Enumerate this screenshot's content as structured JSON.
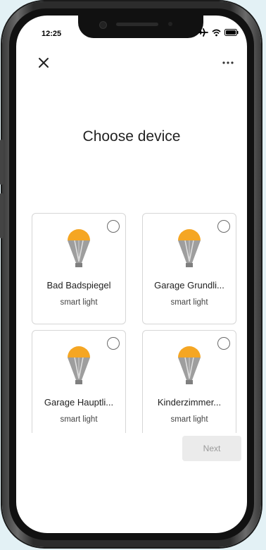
{
  "status_bar": {
    "time": "12:25"
  },
  "header": {
    "title": "Choose device"
  },
  "devices": [
    {
      "name": "Bad Badspiegel",
      "type": "smart light"
    },
    {
      "name": "Garage Grundli...",
      "type": "smart light"
    },
    {
      "name": "Garage Hauptli...",
      "type": "smart light"
    },
    {
      "name": "Kinderzimmer...",
      "type": "smart light"
    }
  ],
  "actions": {
    "next_label": "Next"
  },
  "colors": {
    "bulb_top": "#f5a623",
    "bulb_body": "#9a9a9a",
    "button_disabled_bg": "#ebebeb"
  }
}
